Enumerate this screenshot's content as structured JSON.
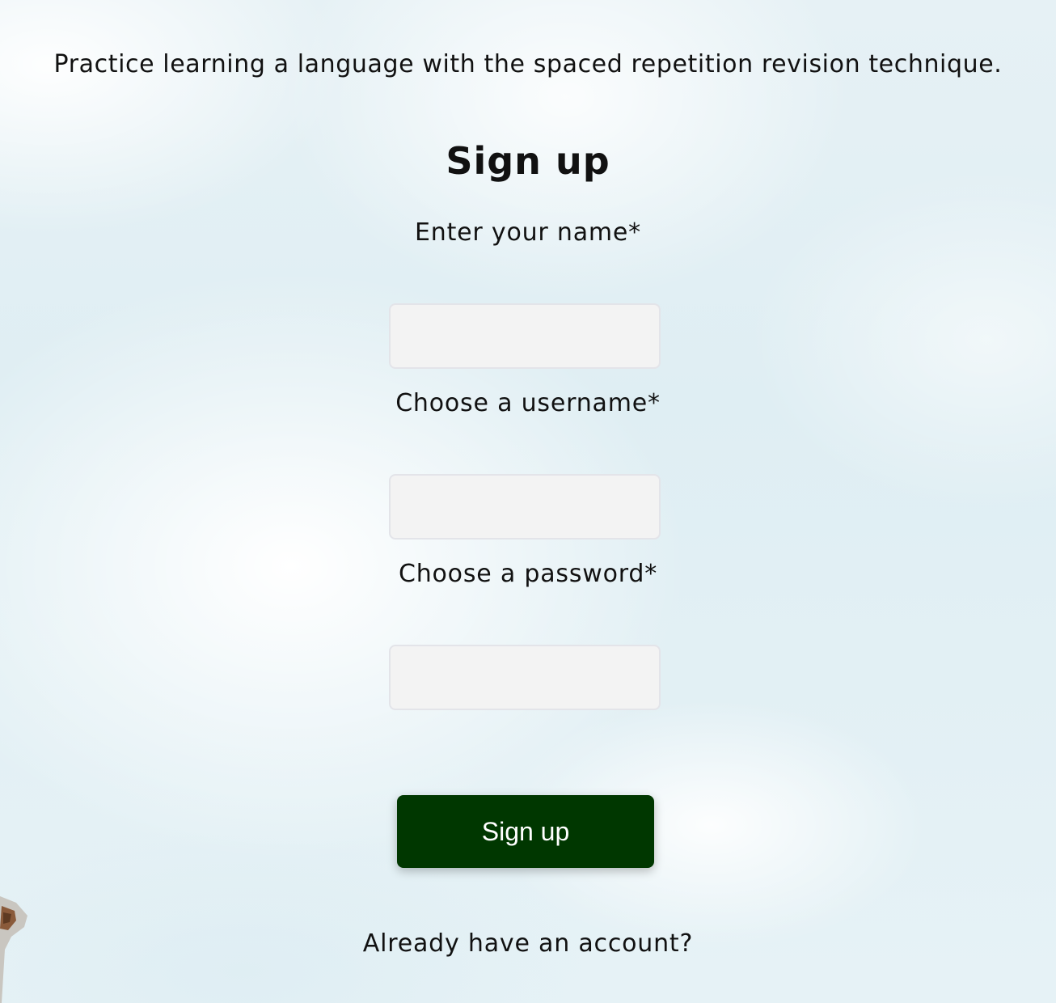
{
  "tagline": "Practice learning a language with the spaced repetition revision technique.",
  "form": {
    "title": "Sign up",
    "name_label": "Enter your name*",
    "name_value": "",
    "username_label": "Choose a username*",
    "username_value": "",
    "password_label": "Choose a password*",
    "password_value": "",
    "submit_label": "Sign up"
  },
  "login_prompt": "Already have an account?",
  "colors": {
    "button_bg": "#003700",
    "button_text": "#ffffff",
    "input_bg": "#f3f3f3",
    "input_border": "#e3e4e9"
  }
}
